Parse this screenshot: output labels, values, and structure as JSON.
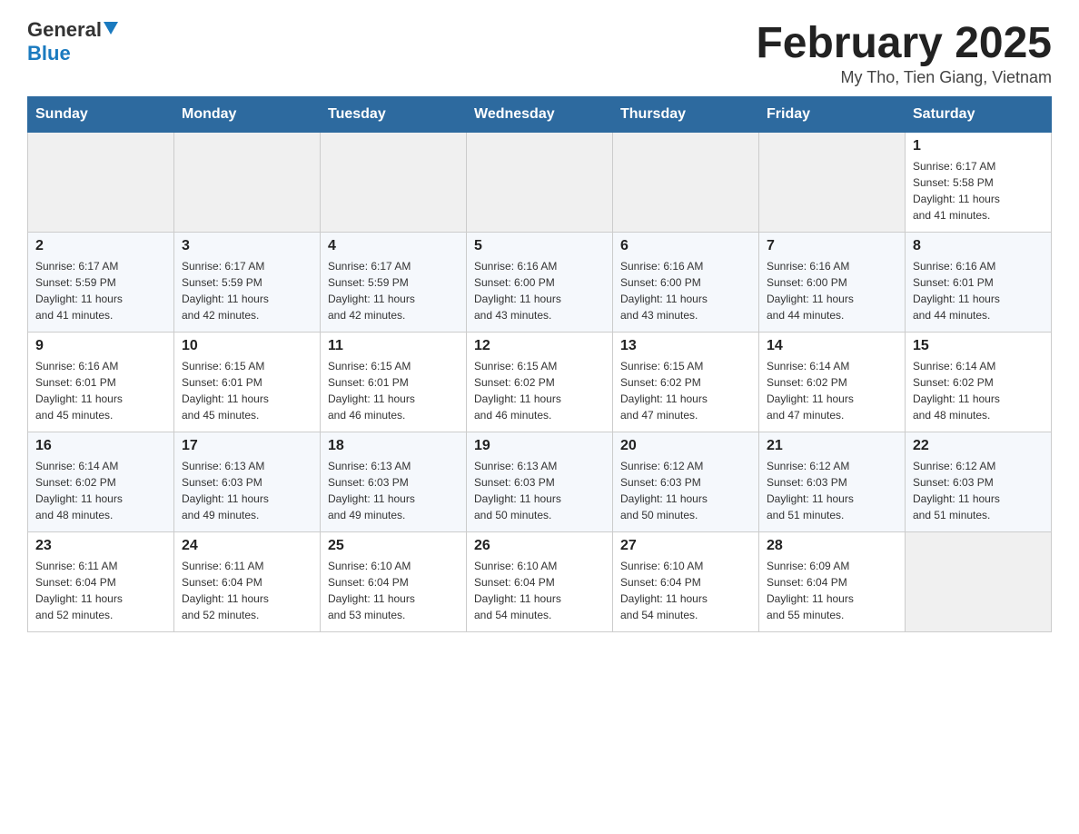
{
  "header": {
    "logo_general": "General",
    "logo_blue": "Blue",
    "month_title": "February 2025",
    "location": "My Tho, Tien Giang, Vietnam"
  },
  "days_of_week": [
    "Sunday",
    "Monday",
    "Tuesday",
    "Wednesday",
    "Thursday",
    "Friday",
    "Saturday"
  ],
  "weeks": [
    [
      {
        "day": "",
        "info": ""
      },
      {
        "day": "",
        "info": ""
      },
      {
        "day": "",
        "info": ""
      },
      {
        "day": "",
        "info": ""
      },
      {
        "day": "",
        "info": ""
      },
      {
        "day": "",
        "info": ""
      },
      {
        "day": "1",
        "info": "Sunrise: 6:17 AM\nSunset: 5:58 PM\nDaylight: 11 hours\nand 41 minutes."
      }
    ],
    [
      {
        "day": "2",
        "info": "Sunrise: 6:17 AM\nSunset: 5:59 PM\nDaylight: 11 hours\nand 41 minutes."
      },
      {
        "day": "3",
        "info": "Sunrise: 6:17 AM\nSunset: 5:59 PM\nDaylight: 11 hours\nand 42 minutes."
      },
      {
        "day": "4",
        "info": "Sunrise: 6:17 AM\nSunset: 5:59 PM\nDaylight: 11 hours\nand 42 minutes."
      },
      {
        "day": "5",
        "info": "Sunrise: 6:16 AM\nSunset: 6:00 PM\nDaylight: 11 hours\nand 43 minutes."
      },
      {
        "day": "6",
        "info": "Sunrise: 6:16 AM\nSunset: 6:00 PM\nDaylight: 11 hours\nand 43 minutes."
      },
      {
        "day": "7",
        "info": "Sunrise: 6:16 AM\nSunset: 6:00 PM\nDaylight: 11 hours\nand 44 minutes."
      },
      {
        "day": "8",
        "info": "Sunrise: 6:16 AM\nSunset: 6:01 PM\nDaylight: 11 hours\nand 44 minutes."
      }
    ],
    [
      {
        "day": "9",
        "info": "Sunrise: 6:16 AM\nSunset: 6:01 PM\nDaylight: 11 hours\nand 45 minutes."
      },
      {
        "day": "10",
        "info": "Sunrise: 6:15 AM\nSunset: 6:01 PM\nDaylight: 11 hours\nand 45 minutes."
      },
      {
        "day": "11",
        "info": "Sunrise: 6:15 AM\nSunset: 6:01 PM\nDaylight: 11 hours\nand 46 minutes."
      },
      {
        "day": "12",
        "info": "Sunrise: 6:15 AM\nSunset: 6:02 PM\nDaylight: 11 hours\nand 46 minutes."
      },
      {
        "day": "13",
        "info": "Sunrise: 6:15 AM\nSunset: 6:02 PM\nDaylight: 11 hours\nand 47 minutes."
      },
      {
        "day": "14",
        "info": "Sunrise: 6:14 AM\nSunset: 6:02 PM\nDaylight: 11 hours\nand 47 minutes."
      },
      {
        "day": "15",
        "info": "Sunrise: 6:14 AM\nSunset: 6:02 PM\nDaylight: 11 hours\nand 48 minutes."
      }
    ],
    [
      {
        "day": "16",
        "info": "Sunrise: 6:14 AM\nSunset: 6:02 PM\nDaylight: 11 hours\nand 48 minutes."
      },
      {
        "day": "17",
        "info": "Sunrise: 6:13 AM\nSunset: 6:03 PM\nDaylight: 11 hours\nand 49 minutes."
      },
      {
        "day": "18",
        "info": "Sunrise: 6:13 AM\nSunset: 6:03 PM\nDaylight: 11 hours\nand 49 minutes."
      },
      {
        "day": "19",
        "info": "Sunrise: 6:13 AM\nSunset: 6:03 PM\nDaylight: 11 hours\nand 50 minutes."
      },
      {
        "day": "20",
        "info": "Sunrise: 6:12 AM\nSunset: 6:03 PM\nDaylight: 11 hours\nand 50 minutes."
      },
      {
        "day": "21",
        "info": "Sunrise: 6:12 AM\nSunset: 6:03 PM\nDaylight: 11 hours\nand 51 minutes."
      },
      {
        "day": "22",
        "info": "Sunrise: 6:12 AM\nSunset: 6:03 PM\nDaylight: 11 hours\nand 51 minutes."
      }
    ],
    [
      {
        "day": "23",
        "info": "Sunrise: 6:11 AM\nSunset: 6:04 PM\nDaylight: 11 hours\nand 52 minutes."
      },
      {
        "day": "24",
        "info": "Sunrise: 6:11 AM\nSunset: 6:04 PM\nDaylight: 11 hours\nand 52 minutes."
      },
      {
        "day": "25",
        "info": "Sunrise: 6:10 AM\nSunset: 6:04 PM\nDaylight: 11 hours\nand 53 minutes."
      },
      {
        "day": "26",
        "info": "Sunrise: 6:10 AM\nSunset: 6:04 PM\nDaylight: 11 hours\nand 54 minutes."
      },
      {
        "day": "27",
        "info": "Sunrise: 6:10 AM\nSunset: 6:04 PM\nDaylight: 11 hours\nand 54 minutes."
      },
      {
        "day": "28",
        "info": "Sunrise: 6:09 AM\nSunset: 6:04 PM\nDaylight: 11 hours\nand 55 minutes."
      },
      {
        "day": "",
        "info": ""
      }
    ]
  ]
}
